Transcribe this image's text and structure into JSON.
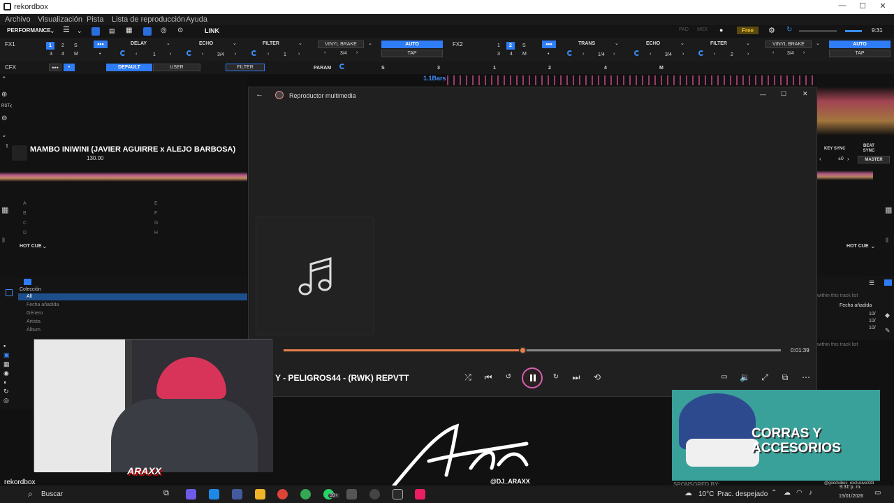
{
  "window": {
    "title": "rekordbox"
  },
  "menu": [
    "Archivo",
    "Visualización",
    "Pista",
    "Lista de reproducción",
    "Ayuda"
  ],
  "toolbar": {
    "mode": "PERFORMANCE",
    "link": "LINK",
    "pad": "PAD",
    "midi": "MIDI",
    "free": "Free",
    "time": "9:31"
  },
  "fx1": {
    "label": "FX1",
    "nums": [
      "1",
      "2",
      "S",
      "3",
      "4",
      "M"
    ],
    "effects": [
      "DELAY",
      "ECHO",
      "FILTER"
    ],
    "vals": [
      "3/4",
      "1"
    ],
    "vinyl": "VINYL BRAKE",
    "auto": "AUTO",
    "tap": "TAP",
    "ratio": "3/4"
  },
  "fx2": {
    "label": "FX2",
    "nums": [
      "1",
      "2",
      "S",
      "3",
      "4",
      "M"
    ],
    "effects": [
      "TRANS",
      "ECHO",
      "FILTER"
    ],
    "vals": [
      "1/4",
      "3/4",
      "2"
    ],
    "vinyl": "VINYL BRAKE",
    "auto": "AUTO",
    "tap": "TAP",
    "ratio": "3/4"
  },
  "cfx": {
    "label": "CFX",
    "default": "DEFAULT",
    "user": "USER",
    "filter": "FILTER",
    "param": "PARAM",
    "s": "S",
    "nums": [
      "3",
      "1",
      "2",
      "4",
      "M"
    ]
  },
  "deck": {
    "bars": "1.1Bars",
    "num": "1",
    "title": "MAMBO INIWINI (JAVIER AGUIRRE x ALEJO BARBOSA)",
    "bpm": "130.00",
    "rst": "RST",
    "hotcue": "HOT CUE",
    "pads": [
      "A",
      "B",
      "C",
      "D",
      "E",
      "F",
      "G",
      "H"
    ],
    "keysync": "KEY SYNC",
    "beatsync": "BEAT SYNC",
    "pm": "±0",
    "master": "MASTER"
  },
  "collection": {
    "header": "Colección",
    "all": "All",
    "items": [
      "Fecha añadida",
      "Género",
      "Artista",
      "Álbum"
    ],
    "search": "within this track list",
    "col": "Fecha añadida",
    "vals": [
      "10/",
      "10/",
      "10/"
    ]
  },
  "player": {
    "title": "Reproductor multimedia",
    "track": "Y - PELIGROS44 - (RWK) REPVTT",
    "time": "0:01:39",
    "progress": 0.48
  },
  "promo": {
    "line1": "CORRAS Y",
    "line2": "ACCESORIOS",
    "sponsored": "SPONSORED BY:",
    "handle": "@goodvibes_exclusive333"
  },
  "overlay": {
    "brand": "rekordbox",
    "handle": "@DJ_ARAXX",
    "dj": "ARAXX"
  },
  "taskbar": {
    "search": "Buscar",
    "weather": "10°C",
    "cond": "Prac. despejado",
    "time": "9:31 p. m.",
    "date": "15/01/2026",
    "badge": "99+"
  }
}
